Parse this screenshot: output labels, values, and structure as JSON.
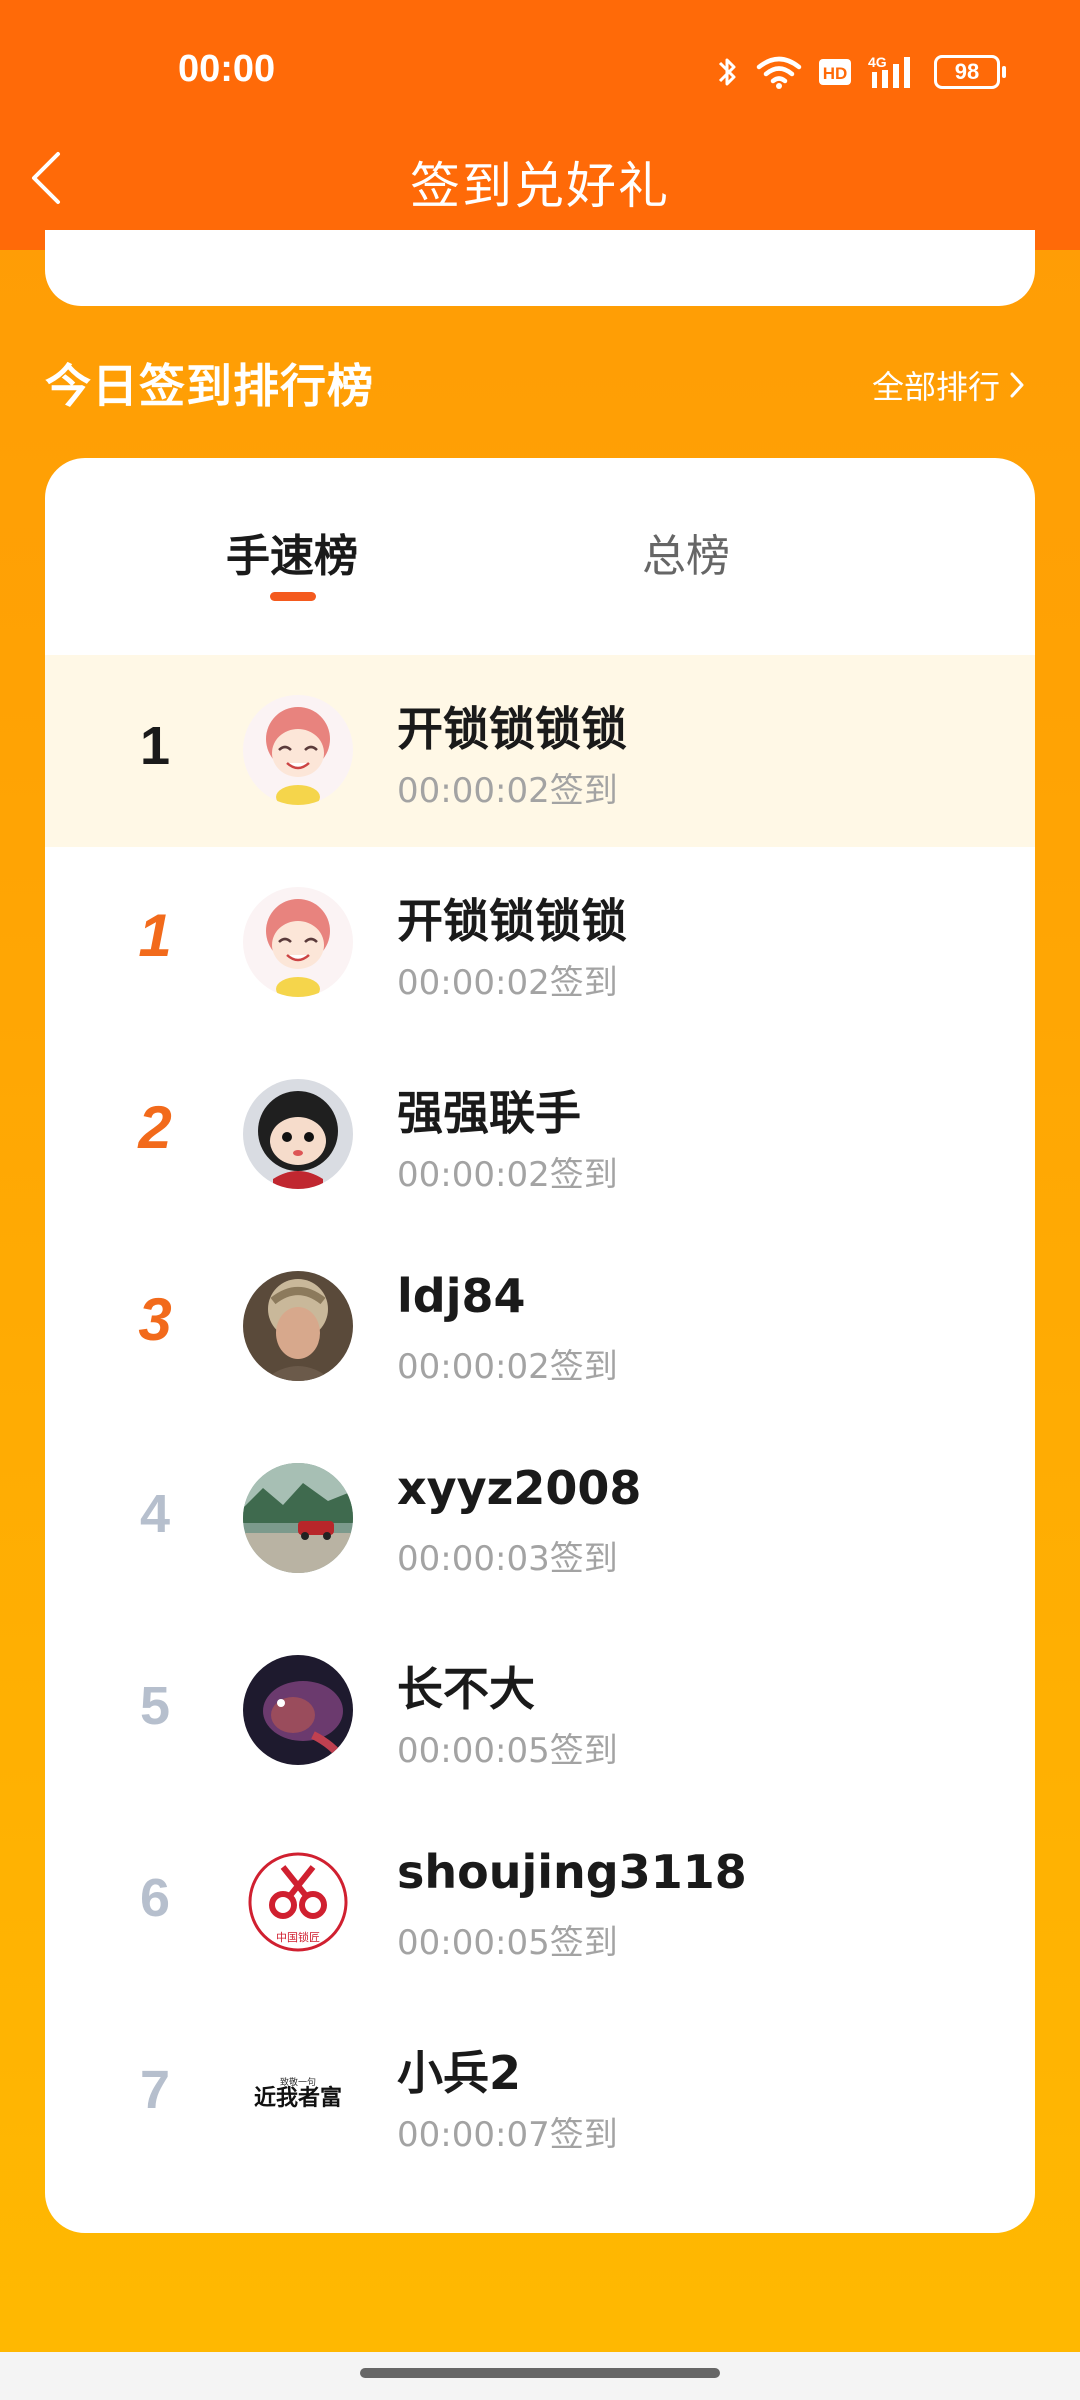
{
  "status_bar": {
    "time": "00:00",
    "battery": "98"
  },
  "header": {
    "title": "签到兑好礼"
  },
  "section": {
    "title": "今日签到排行榜",
    "see_all": "全部排行"
  },
  "tabs": [
    {
      "label": "手速榜",
      "active": true
    },
    {
      "label": "总榜",
      "active": false
    }
  ],
  "colors": {
    "header": "#FF6A08",
    "accent": "#F45A1E",
    "rank_top": "#F26A1B"
  },
  "leaderboard": [
    {
      "rank": "1",
      "name": "开锁锁锁锁",
      "time": "00:00:02签到",
      "avatar": "anime-girl-avatar",
      "highlight": true
    },
    {
      "rank": "1",
      "name": "开锁锁锁锁",
      "time": "00:00:02签到",
      "avatar": "anime-girl-avatar"
    },
    {
      "rank": "2",
      "name": "强强联手",
      "time": "00:00:02签到",
      "avatar": "cartoon-face-avatar"
    },
    {
      "rank": "3",
      "name": "ldj84",
      "time": "00:00:02签到",
      "avatar": "photo-avatar"
    },
    {
      "rank": "4",
      "name": "xyyz2008",
      "time": "00:00:03签到",
      "avatar": "car-landscape-avatar"
    },
    {
      "rank": "5",
      "name": "长不大",
      "time": "00:00:05签到",
      "avatar": "fish-avatar"
    },
    {
      "rank": "6",
      "name": "shoujing3118",
      "time": "00:00:05签到",
      "avatar": "keys-logo-avatar"
    },
    {
      "rank": "7",
      "name": "小兵2",
      "time": "00:00:07签到",
      "avatar": "text-logo-avatar"
    }
  ],
  "avatar_texts": {
    "keys_logo": "中国锁匠",
    "text_logo_small": "致敬一句",
    "text_logo_main": "近我者富"
  }
}
